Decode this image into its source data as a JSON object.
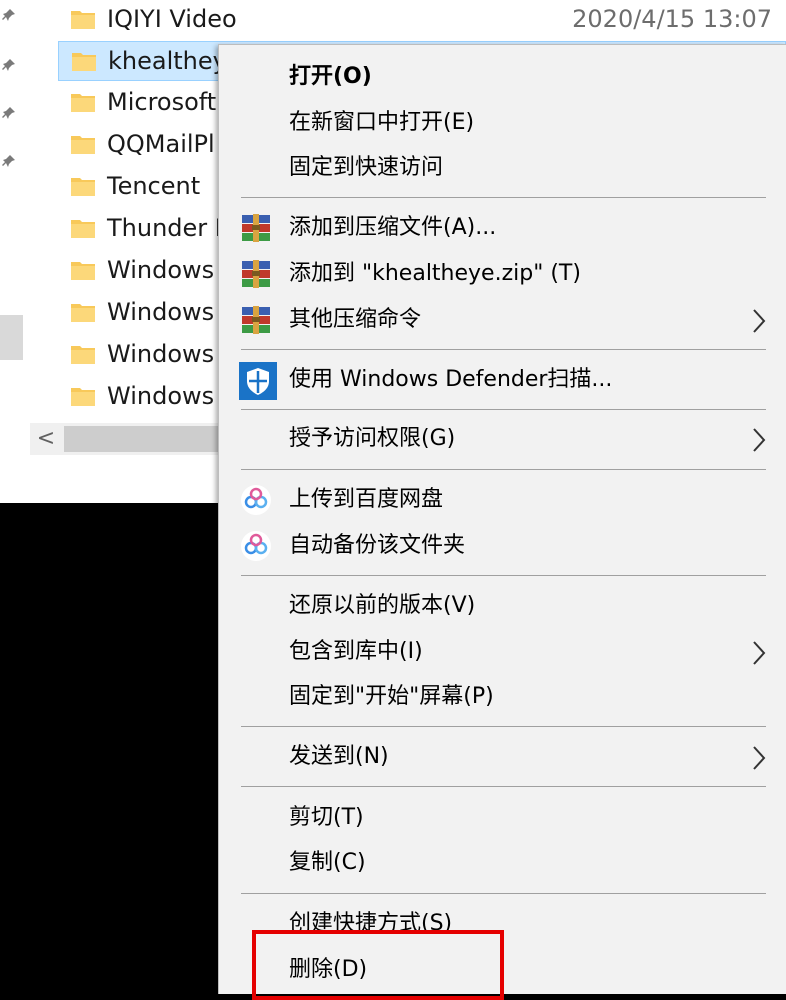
{
  "explorer": {
    "files": [
      {
        "name": "IQIYI Video",
        "date": "2020/4/15 13:07"
      },
      {
        "name": "khealtheye",
        "date": ""
      },
      {
        "name": "Microsoft",
        "date": ""
      },
      {
        "name": "QQMailPl",
        "date": ""
      },
      {
        "name": "Tencent",
        "date": ""
      },
      {
        "name": "Thunder N",
        "date": ""
      },
      {
        "name": "Windows",
        "date": ""
      },
      {
        "name": "Windows",
        "date": ""
      },
      {
        "name": "Windows",
        "date": ""
      },
      {
        "name": "Windows",
        "date": ""
      }
    ],
    "scroll_left": "<"
  },
  "context_menu": {
    "open": "打开(O)",
    "open_new_window": "在新窗口中打开(E)",
    "pin_quick_access": "固定到快速访问",
    "add_to_archive": "添加到压缩文件(A)...",
    "add_to_zip": "添加到 \"khealtheye.zip\" (T)",
    "other_compress": "其他压缩命令",
    "defender_scan": "使用 Windows Defender扫描...",
    "grant_access": "授予访问权限(G)",
    "upload_baidu": "上传到百度网盘",
    "auto_backup": "自动备份该文件夹",
    "restore_versions": "还原以前的版本(V)",
    "include_library": "包含到库中(I)",
    "pin_start": "固定到\"开始\"屏幕(P)",
    "send_to": "发送到(N)",
    "cut": "剪切(T)",
    "copy": "复制(C)",
    "create_shortcut": "创建快捷方式(S)",
    "delete": "删除(D)"
  },
  "colors": {
    "highlight_box": "#e50000",
    "selection": "#cce8ff",
    "menu_bg": "#f2f2f2"
  }
}
